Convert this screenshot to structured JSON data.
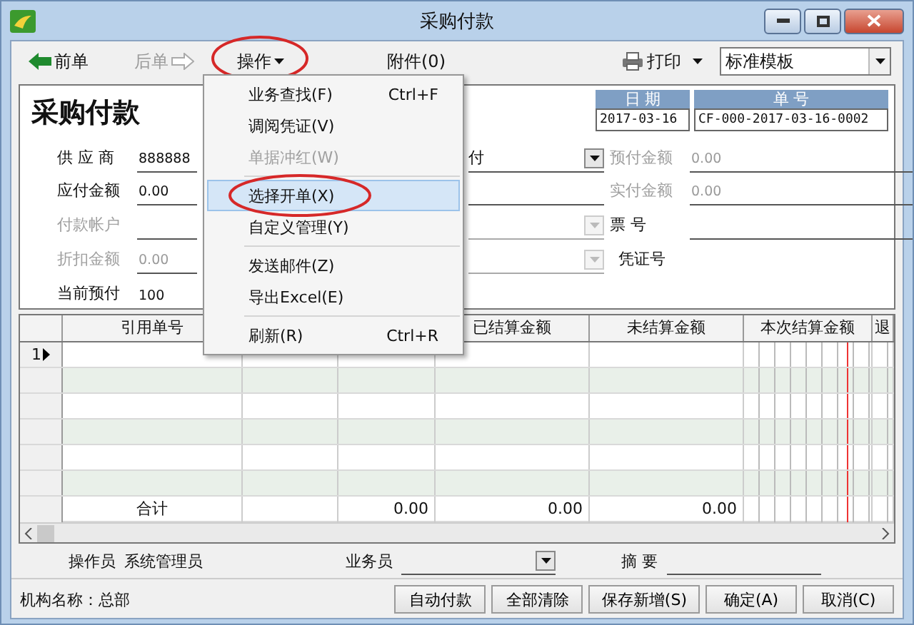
{
  "window": {
    "title": "采购付款"
  },
  "toolbar": {
    "prev": {
      "label": "前单",
      "disabled": false
    },
    "next": {
      "label": "后单",
      "disabled": true
    },
    "operate": {
      "label": "操作",
      "circled": true
    },
    "attachment": "附件(0)",
    "print": "打印",
    "template": "标准模板"
  },
  "menu": {
    "groups": [
      [
        {
          "label": "业务查找(F)",
          "shortcut": "Ctrl+F",
          "disabled": false,
          "selected": false,
          "circled": false
        },
        {
          "label": "调阅凭证(V)",
          "disabled": false,
          "selected": false,
          "circled": false
        },
        {
          "label": "单据冲红(W)",
          "disabled": true,
          "selected": false,
          "circled": false
        }
      ],
      [
        {
          "label": "选择开单(X)",
          "disabled": false,
          "selected": true,
          "circled": true
        },
        {
          "label": "自定义管理(Y)",
          "disabled": false,
          "selected": false,
          "circled": false
        }
      ],
      [
        {
          "label": "发送邮件(Z)",
          "disabled": false,
          "selected": false,
          "circled": false
        },
        {
          "label": "导出Excel(E)",
          "disabled": false,
          "selected": false,
          "circled": false
        }
      ],
      [
        {
          "label": "刷新(R)",
          "shortcut": "Ctrl+R",
          "disabled": false,
          "selected": false,
          "circled": false
        }
      ]
    ]
  },
  "form": {
    "title": "采购付款",
    "date": {
      "label": "日 期",
      "value": "2017-03-16"
    },
    "number": {
      "label": "单 号",
      "value": "CF-000-2017-03-16-0002"
    },
    "left_fields": [
      {
        "label": "供 应 商",
        "value": "888888",
        "disabled": false
      },
      {
        "label": "应付金额",
        "value": "0.00",
        "disabled": false
      },
      {
        "label": "付款帐户",
        "disabled": true
      },
      {
        "label": "折扣金额",
        "value": "0.00",
        "disabled": true
      },
      {
        "label": "当前预付",
        "value": "100",
        "disabled": false,
        "kind": "plain"
      }
    ],
    "middle_fields": [
      {
        "kind": "dropdown",
        "value": "付",
        "disabled": false
      },
      {
        "kind": "line"
      },
      {
        "kind": "dropdown",
        "disabled": true
      },
      {
        "kind": "dropdown",
        "disabled": true
      }
    ],
    "right_fields": [
      {
        "label": "预付金额",
        "value": "0.00",
        "disabled": true,
        "kind": "line"
      },
      {
        "label": "实付金额",
        "value": "0.00",
        "disabled": true,
        "kind": "line"
      },
      {
        "label": "票 号",
        "disabled": false,
        "kind": "line"
      },
      {
        "label": "凭证号",
        "disabled": false,
        "kind": "plain"
      }
    ]
  },
  "grid": {
    "columns": [
      {
        "label": "引用单号"
      },
      {},
      {},
      {
        "label": "已结算金额"
      },
      {
        "label": "未结算金额"
      },
      {
        "label": "本次结算金额"
      },
      {
        "label": "退"
      }
    ],
    "rows": [
      {
        "number": "1",
        "current": true
      },
      {
        "current": false
      },
      {
        "current": false
      },
      {
        "current": false
      },
      {
        "current": false
      },
      {
        "current": false
      }
    ],
    "total": {
      "label": "合计",
      "cells": [
        null,
        null,
        "0.00",
        "0.00",
        "0.00",
        null,
        null
      ]
    }
  },
  "footer": {
    "operator": {
      "label": "操作员",
      "value": "系统管理员"
    },
    "salesperson": {
      "label": "业务员"
    },
    "summary": {
      "label": "摘 要"
    }
  },
  "status": {
    "org": "机构名称：总部",
    "buttons": [
      "自动付款",
      "全部清除",
      "保存新增(S)",
      "确定(A)",
      "取消(C)"
    ]
  }
}
